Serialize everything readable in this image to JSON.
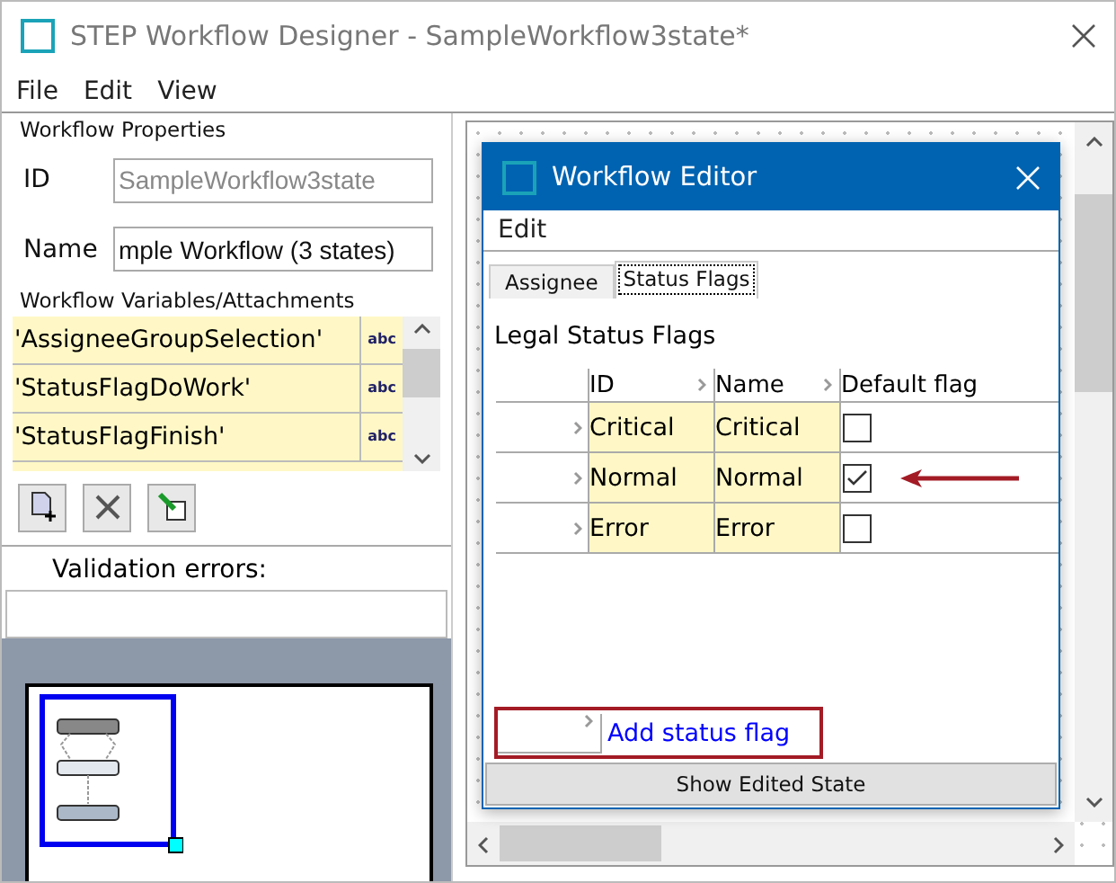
{
  "window": {
    "title": "STEP Workflow Designer - SampleWorkflow3state*"
  },
  "menu": [
    "File",
    "Edit",
    "View"
  ],
  "properties": {
    "title": "Workflow Properties",
    "fields": [
      {
        "label": "ID",
        "value": "SampleWorkflow3state",
        "disabled": true
      },
      {
        "label": "Name",
        "value": "mple Workflow (3 states)",
        "disabled": false
      }
    ]
  },
  "variables": {
    "title": "Workflow Variables/Attachments",
    "items": [
      {
        "name": "'AssigneeGroupSelection'",
        "type": "abc"
      },
      {
        "name": "'StatusFlagDoWork'",
        "type": "abc"
      },
      {
        "name": "'StatusFlagFinish'",
        "type": "abc"
      }
    ]
  },
  "validation": {
    "label": "Validation errors:"
  },
  "dialog": {
    "title": "Workflow Editor",
    "menu": [
      "Edit"
    ],
    "tabs": [
      {
        "label": "Assignee",
        "selected": false
      },
      {
        "label": "Status Flags",
        "selected": true
      }
    ],
    "section": "Legal Status Flags",
    "columns": [
      "ID",
      "Name",
      "Default flag"
    ],
    "rows": [
      {
        "id": "Critical",
        "name": "Critical",
        "checked": false
      },
      {
        "id": "Normal",
        "name": "Normal",
        "checked": true
      },
      {
        "id": "Error",
        "name": "Error",
        "checked": false
      }
    ],
    "add_link": "Add status flag",
    "button": "Show Edited State"
  }
}
